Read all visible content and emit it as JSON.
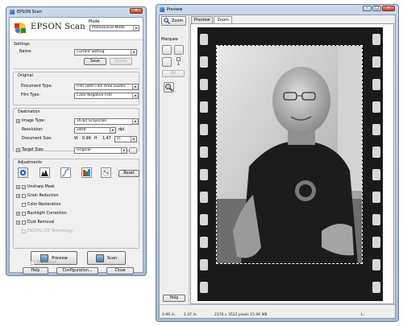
{
  "left_window": {
    "title": "EPSON Scan",
    "app_name": "EPSON Scan",
    "mode": {
      "label": "Mode",
      "value": "Professional Mode"
    },
    "settings": {
      "label": "Settings",
      "name_label": "Name:",
      "name_value": "Current Setting",
      "save_label": "Save",
      "delete_label": "Delete"
    },
    "original": {
      "label": "Original",
      "document_type_label": "Document Type:",
      "document_type_value": "Film (with Film Area Guide)",
      "film_type_label": "Film Type:",
      "film_type_value": "Color Negative Film"
    },
    "destination": {
      "label": "Destination",
      "image_type_label": "Image Type:",
      "image_type_value": "16-bit Grayscale",
      "resolution_label": "Resolution:",
      "resolution_value": "2400",
      "resolution_unit": "dpi",
      "document_size_label": "Document Size:",
      "width_prefix": "W",
      "width_value": "0.99",
      "height_prefix": "H",
      "height_value": "1.47",
      "size_unit": "in."
    },
    "target_size": {
      "label": "Target Size:",
      "value": "Original"
    },
    "adjustments": {
      "label": "Adjustments",
      "reset_label": "Reset",
      "unsharp_mask": "Unsharp Mask",
      "grain_reduction": "Grain Reduction",
      "color_restoration": "Color Restoration",
      "backlight_correction": "Backlight Correction",
      "dust_removal": "Dust Removal",
      "digital_ice": "DIGITAL ICE Technology"
    },
    "preview_label": "Preview",
    "scan_label": "Scan",
    "thumbnail_label": "Thumbnail",
    "help_label": "Help",
    "configuration_label": "Configuration...",
    "close_label": "Close"
  },
  "right_window": {
    "title": "Preview",
    "zoom_button_label": "Zoom",
    "tabs": [
      {
        "label": "Preview"
      },
      {
        "label": "Zoom"
      }
    ],
    "marquee_label": "Marquee",
    "marquee_count": "1",
    "all_label": "All",
    "help_label": "Help",
    "status": {
      "width": "0.99 in.",
      "height": "1.47 in.",
      "pixels": "2376 x 3522 pixels 15.96 MB",
      "luminance": "L:"
    }
  },
  "colors": {
    "title_bar": "#b9cbe0",
    "client_bg": "#f0f0f0",
    "film": "#1a1a1a"
  },
  "icons": [
    "epson-logo-icon",
    "zoom-icon",
    "marquee-icon",
    "auto-locate-icon",
    "histogram-icon",
    "tone-curve-icon",
    "image-adjust-icon",
    "color-palette-icon"
  ]
}
